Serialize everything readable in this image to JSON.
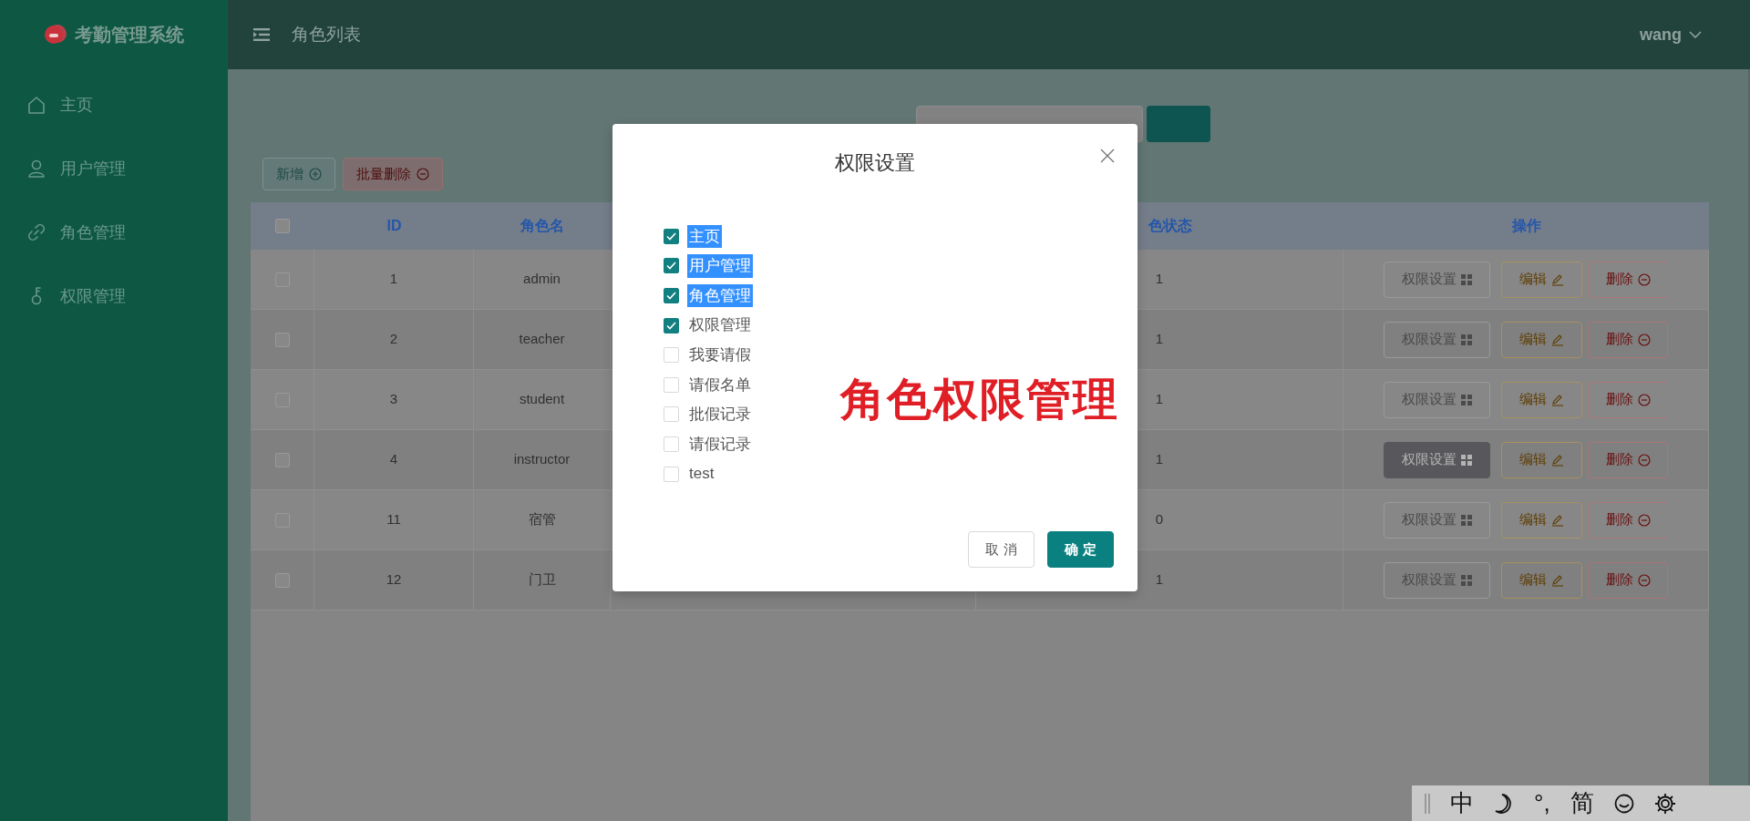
{
  "app": {
    "logo_text": "考勤管理系统"
  },
  "sidebar": {
    "items": [
      {
        "label": "主页",
        "kind": "home"
      },
      {
        "label": "用户管理",
        "kind": "user"
      },
      {
        "label": "角色管理",
        "kind": "link"
      },
      {
        "label": "权限管理",
        "kind": "key"
      }
    ]
  },
  "header": {
    "title": "角色列表",
    "user": "wang"
  },
  "toolbar": {
    "buttons": [
      {
        "label": "新增",
        "kind": "add"
      },
      {
        "label": "批量删除",
        "kind": "delete"
      }
    ]
  },
  "table": {
    "header_checked": false,
    "columns": [
      {
        "label": "ID"
      },
      {
        "label": "角色名"
      },
      {
        "label": "色状态"
      },
      {
        "label": "操作"
      }
    ],
    "rows": [
      {
        "checked": false,
        "id": "1",
        "name": "admin",
        "status": "1",
        "permission_hovered": false,
        "actions": [
          {
            "label": "权限设置",
            "kind": "perm"
          },
          {
            "label": "编辑",
            "kind": "edit"
          },
          {
            "label": "删除",
            "kind": "delete"
          }
        ]
      },
      {
        "checked": false,
        "id": "2",
        "name": "teacher",
        "status": "1",
        "permission_hovered": false,
        "actions": [
          {
            "label": "权限设置",
            "kind": "perm"
          },
          {
            "label": "编辑",
            "kind": "edit"
          },
          {
            "label": "删除",
            "kind": "delete"
          }
        ]
      },
      {
        "checked": false,
        "id": "3",
        "name": "student",
        "status": "1",
        "permission_hovered": false,
        "actions": [
          {
            "label": "权限设置",
            "kind": "perm"
          },
          {
            "label": "编辑",
            "kind": "edit"
          },
          {
            "label": "删除",
            "kind": "delete"
          }
        ]
      },
      {
        "checked": false,
        "id": "4",
        "name": "instructor",
        "status": "1",
        "permission_hovered": true,
        "actions": [
          {
            "label": "权限设置",
            "kind": "perm"
          },
          {
            "label": "编辑",
            "kind": "edit"
          },
          {
            "label": "删除",
            "kind": "delete"
          }
        ]
      },
      {
        "checked": false,
        "id": "11",
        "name": "宿管",
        "status": "0",
        "permission_hovered": false,
        "actions": [
          {
            "label": "权限设置",
            "kind": "perm"
          },
          {
            "label": "编辑",
            "kind": "edit"
          },
          {
            "label": "删除",
            "kind": "delete"
          }
        ]
      },
      {
        "checked": false,
        "id": "12",
        "name": "门卫",
        "status": "1",
        "permission_hovered": false,
        "actions": [
          {
            "label": "权限设置",
            "kind": "perm"
          },
          {
            "label": "编辑",
            "kind": "edit"
          },
          {
            "label": "删除",
            "kind": "delete"
          }
        ]
      }
    ]
  },
  "modal": {
    "title": "权限设置",
    "permissions": [
      {
        "label": "主页",
        "checked": true,
        "highlighted": true
      },
      {
        "label": "用户管理",
        "checked": true,
        "highlighted": true
      },
      {
        "label": "角色管理",
        "checked": true,
        "highlighted": true
      },
      {
        "label": "权限管理",
        "checked": true,
        "highlighted": false
      },
      {
        "label": "我要请假",
        "checked": false,
        "highlighted": false
      },
      {
        "label": "请假名单",
        "checked": false,
        "highlighted": false
      },
      {
        "label": "批假记录",
        "checked": false,
        "highlighted": false
      },
      {
        "label": "请假记录",
        "checked": false,
        "highlighted": false
      },
      {
        "label": "test",
        "checked": false,
        "highlighted": false
      }
    ],
    "annotation": "角色权限管理",
    "buttons": [
      {
        "label": "取 消",
        "kind": "cancel"
      },
      {
        "label": "确 定",
        "kind": "confirm"
      }
    ]
  },
  "ime_bar": {
    "items": [
      {
        "kind": "grip"
      },
      {
        "kind": "text",
        "label": "中"
      },
      {
        "kind": "moon"
      },
      {
        "kind": "text",
        "label": "°,"
      },
      {
        "kind": "text",
        "label": "简"
      },
      {
        "kind": "smiley"
      },
      {
        "kind": "gear"
      }
    ]
  }
}
